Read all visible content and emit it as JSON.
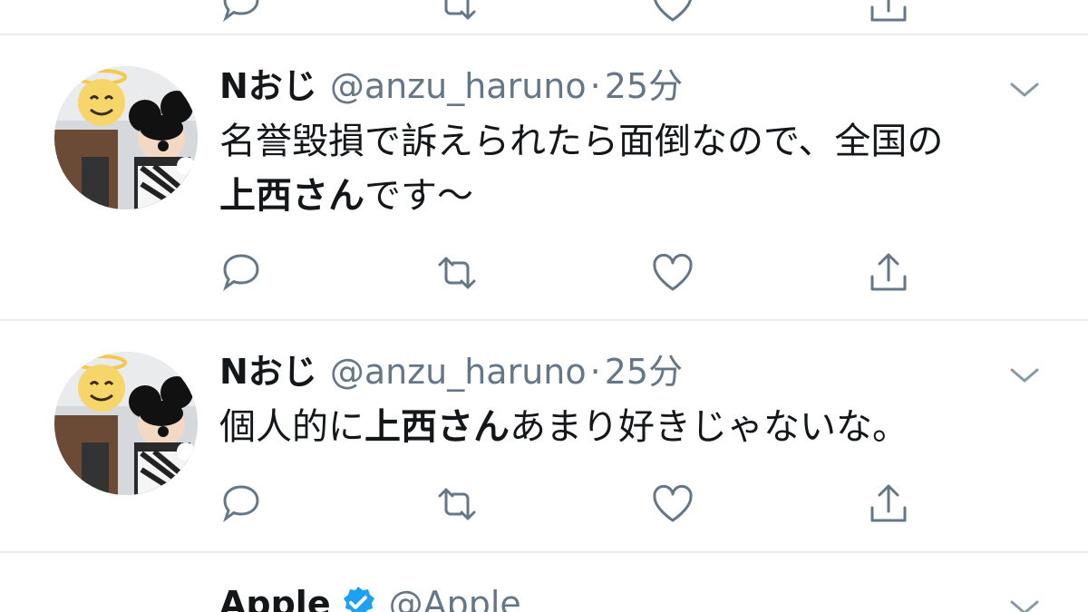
{
  "colors": {
    "text": "#14171a",
    "muted": "#657786",
    "icon": "#657786",
    "divider": "#e6ecf0",
    "verified": "#1da1f2"
  },
  "tweets": [
    {
      "name": "Nおじ",
      "handle": "@anzu_haruno",
      "separator": "·",
      "time": "25分",
      "line1": "名誉毀損で訴えられたら面倒なので、全国の",
      "line2_bold": "上西さん",
      "line2_rest": "です〜"
    },
    {
      "name": "Nおじ",
      "handle": "@anzu_haruno",
      "separator": "·",
      "time": "25分",
      "text_prefix": "個人的に",
      "text_bold": "上西さん",
      "text_suffix": "あまり好きじゃないな。"
    },
    {
      "name": "Apple",
      "handle": "@Apple",
      "verified": true
    }
  ],
  "icons": {
    "reply": "reply-icon",
    "retweet": "retweet-icon",
    "like": "heart-icon",
    "share": "share-icon",
    "menu": "chevron-down-icon",
    "verified": "verified-badge-icon"
  }
}
